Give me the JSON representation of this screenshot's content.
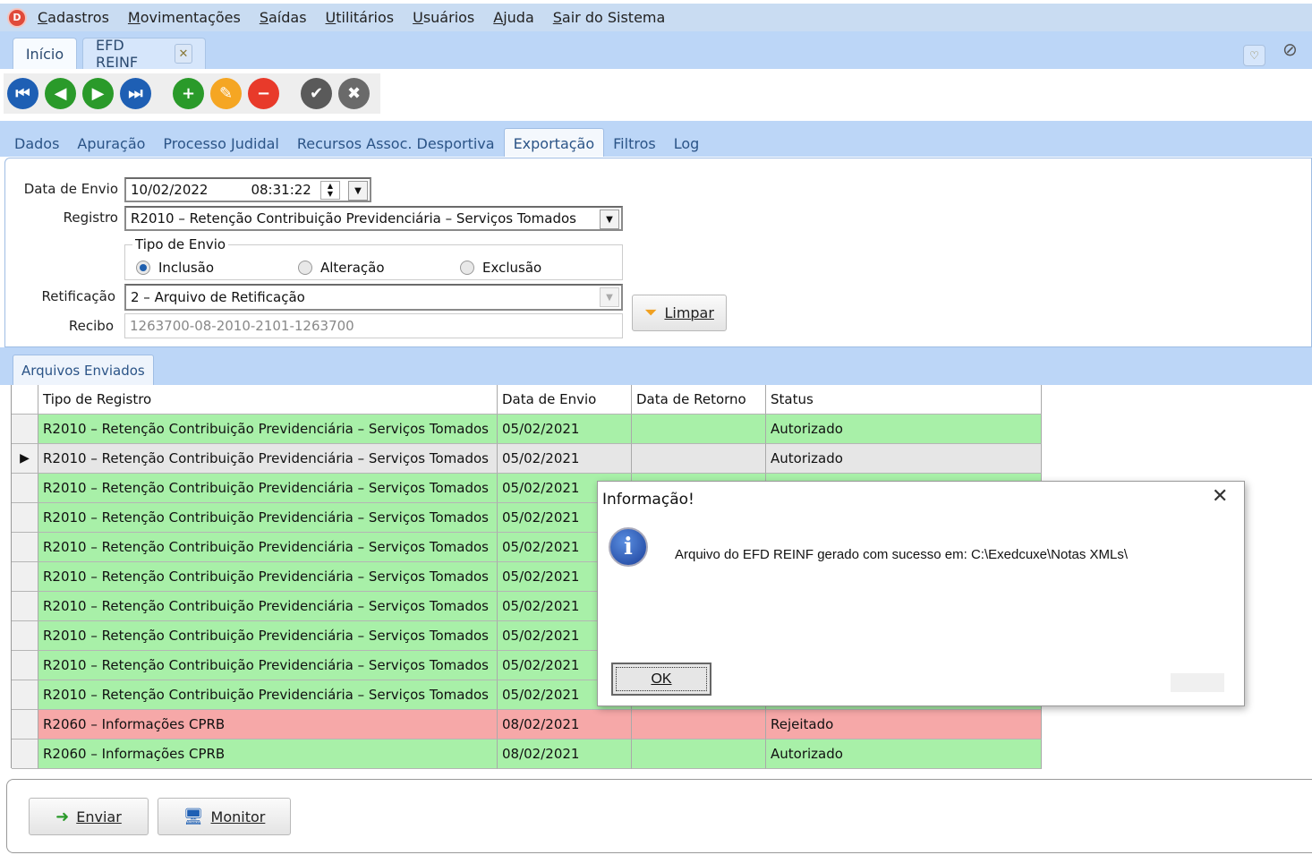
{
  "menu": {
    "items": [
      "Cadastros",
      "Movimentações",
      "Saídas",
      "Utilitários",
      "Usuários",
      "Ajuda",
      "Sair do Sistema"
    ]
  },
  "doc_tabs": [
    {
      "label": "Início"
    },
    {
      "label": "EFD REINF"
    }
  ],
  "sub_tabs": [
    "Dados",
    "Apuração",
    "Processo Judidal",
    "Recursos Assoc. Desportiva",
    "Exportação",
    "Filtros",
    "Log"
  ],
  "form": {
    "data_envio_label": "Data de Envio",
    "data_envio_date": "10/02/2022",
    "data_envio_time": "08:31:22",
    "registro_label": "Registro",
    "registro_value": "R2010 – Retenção Contribuição Previdenciária – Serviços Tomados",
    "tipo_envio_label": "Tipo de Envio",
    "tipo_envio_options": [
      "Inclusão",
      "Alteração",
      "Exclusão"
    ],
    "tipo_envio_selected": "Inclusão",
    "retificacao_label": "Retificação",
    "retificacao_value": "2 – Arquivo de Retificação",
    "recibo_label": "Recibo",
    "recibo_value": "1263700-08-2010-2101-1263700",
    "limpar_label": "Limpar"
  },
  "grid": {
    "tab_label": "Arquivos Enviados",
    "columns": [
      "Tipo de Registro",
      "Data de Envio",
      "Data de Retorno",
      "Status"
    ],
    "rows": [
      {
        "tipo": "R2010 – Retenção Contribuição Previdenciária – Serviços Tomados",
        "envio": "05/02/2021",
        "retorno": "",
        "status": "Autorizado",
        "color": "#a8f0a8"
      },
      {
        "tipo": "R2010 – Retenção Contribuição Previdenciária – Serviços Tomados",
        "envio": "05/02/2021",
        "retorno": "",
        "status": "Autorizado",
        "color": "#e6e6e6",
        "selected": true
      },
      {
        "tipo": "R2010 – Retenção Contribuição Previdenciária – Serviços Tomados",
        "envio": "05/02/2021",
        "retorno": "",
        "status": "",
        "color": "#a8f0a8"
      },
      {
        "tipo": "R2010 – Retenção Contribuição Previdenciária – Serviços Tomados",
        "envio": "05/02/2021",
        "retorno": "",
        "status": "",
        "color": "#a8f0a8"
      },
      {
        "tipo": "R2010 – Retenção Contribuição Previdenciária – Serviços Tomados",
        "envio": "05/02/2021",
        "retorno": "",
        "status": "",
        "color": "#a8f0a8"
      },
      {
        "tipo": "R2010 – Retenção Contribuição Previdenciária – Serviços Tomados",
        "envio": "05/02/2021",
        "retorno": "",
        "status": "",
        "color": "#a8f0a8"
      },
      {
        "tipo": "R2010 – Retenção Contribuição Previdenciária – Serviços Tomados",
        "envio": "05/02/2021",
        "retorno": "",
        "status": "",
        "color": "#a8f0a8"
      },
      {
        "tipo": "R2010 – Retenção Contribuição Previdenciária – Serviços Tomados",
        "envio": "05/02/2021",
        "retorno": "",
        "status": "",
        "color": "#a8f0a8"
      },
      {
        "tipo": "R2010 – Retenção Contribuição Previdenciária – Serviços Tomados",
        "envio": "05/02/2021",
        "retorno": "",
        "status": "",
        "color": "#a8f0a8"
      },
      {
        "tipo": "R2010 – Retenção Contribuição Previdenciária – Serviços Tomados",
        "envio": "05/02/2021",
        "retorno": "",
        "status": "",
        "color": "#a8f0a8"
      },
      {
        "tipo": "R2060 – Informações CPRB",
        "envio": "08/02/2021",
        "retorno": "",
        "status": "Rejeitado",
        "color": "#f6a8a8"
      },
      {
        "tipo": "R2060 – Informações CPRB",
        "envio": "08/02/2021",
        "retorno": "",
        "status": "Autorizado",
        "color": "#a8f0a8"
      }
    ]
  },
  "actions": {
    "enviar_label": "Enviar",
    "monitor_label": "Monitor"
  },
  "dialog": {
    "title": "Informação!",
    "message": "Arquivo do EFD REINF gerado com sucesso em: C:\\Exedcuxe\\Notas XMLs\\",
    "ok_label": "OK"
  }
}
